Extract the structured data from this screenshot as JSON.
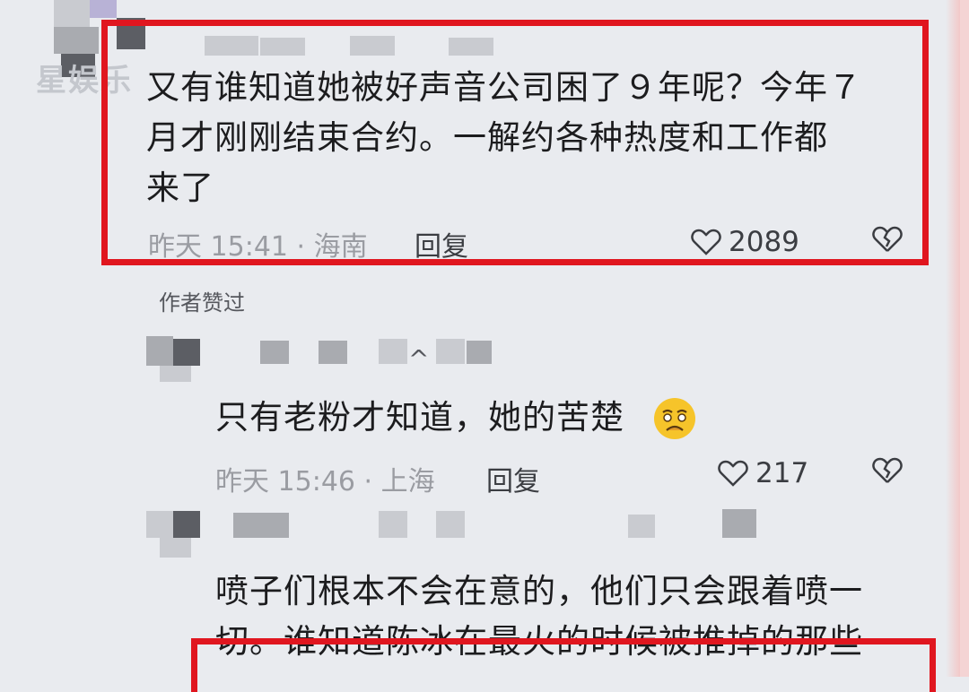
{
  "watermark": "星娱乐",
  "comments": [
    {
      "text_line1": "又有谁知道她被好声音公司困了９年呢？今年７",
      "text_line2": "月才刚刚结束合约。一解约各种热度和工作都",
      "text_line3": "来了",
      "time": "昨天 15:41 · 海南",
      "reply": "回复",
      "likes": "2089"
    },
    {
      "author_liked": "作者赞过",
      "text": "只有老粉才知道，她的苦楚",
      "time": "昨天 15:46 · 上海",
      "reply": "回复",
      "likes": "217"
    },
    {
      "text_line1": "喷子们根本不会在意的，他们只会跟着喷一",
      "text_line2": "切。谁知道陈冰在最火的时候被推掉的那些"
    }
  ],
  "colors": {
    "highlight": "#e0161f",
    "background": "#e9ebef"
  },
  "icons": {
    "like": "heart-outline-icon",
    "dislike": "broken-heart-icon"
  }
}
